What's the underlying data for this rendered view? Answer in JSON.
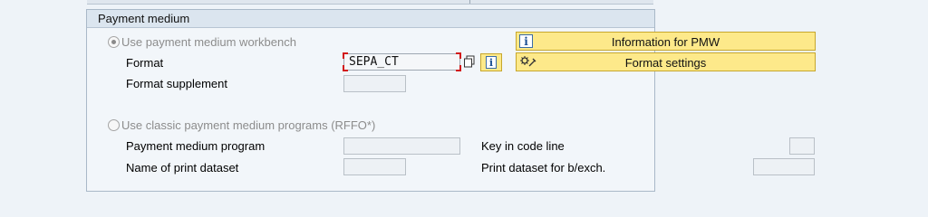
{
  "group": {
    "title": "Payment medium"
  },
  "pmw": {
    "radio_label": "Use payment medium workbench",
    "format_label": "Format",
    "format_value": "SEPA_CT",
    "format_supplement_label": "Format supplement",
    "format_supplement_value": "",
    "info_button_label": "Information for PMW",
    "settings_button_label": "Format settings"
  },
  "classic": {
    "radio_label": "Use classic payment medium programs (RFFO*)",
    "program_label": "Payment medium program",
    "program_value": "",
    "print_dataset_label": "Name of print dataset",
    "print_dataset_value": "",
    "key_code_label": "Key in code line",
    "key_code_value": "",
    "print_bexch_label": "Print dataset for b/exch.",
    "print_bexch_value": ""
  },
  "icons": {
    "info": "info-icon",
    "settings": "settings-gear-icon",
    "copy": "copy-icon"
  }
}
